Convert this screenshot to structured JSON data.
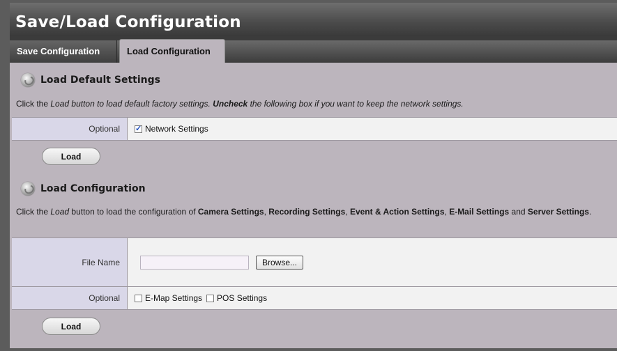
{
  "window": {
    "title": "Save/Load Configuration"
  },
  "tabs": [
    {
      "label": "Save Configuration",
      "active": false
    },
    {
      "label": "Load Configuration",
      "active": true
    }
  ],
  "default_section": {
    "title": "Load Default Settings",
    "desc_pre": "Click the ",
    "desc_load": "Load",
    "desc_mid": " button to load default factory settings. ",
    "desc_uncheck": "Uncheck",
    "desc_post": " the following box if you want to keep the network settings.",
    "optional_label": "Optional",
    "network_checkbox_label": "Network Settings",
    "network_checked": true,
    "load_button": "Load"
  },
  "config_section": {
    "title": "Load Configuration",
    "desc_pre": "Click the ",
    "desc_load": "Load",
    "desc_mid": " button to load the configuration of ",
    "camera": "Camera Settings",
    "sep1": ", ",
    "recording": "Recording Settings",
    "sep2": ", ",
    "event": "Event & Action Settings",
    "sep3": ", ",
    "email": "E-Mail Settings",
    "and": " and ",
    "server": "Server Settings",
    "end": ".",
    "file_label": "File Name",
    "file_value": "",
    "browse_button": "Browse...",
    "optional_label": "Optional",
    "emap_label": "E-Map Settings",
    "emap_checked": false,
    "pos_label": "POS Settings",
    "pos_checked": false,
    "load_button": "Load"
  },
  "icons": {
    "section_icon": "disc-icon"
  }
}
